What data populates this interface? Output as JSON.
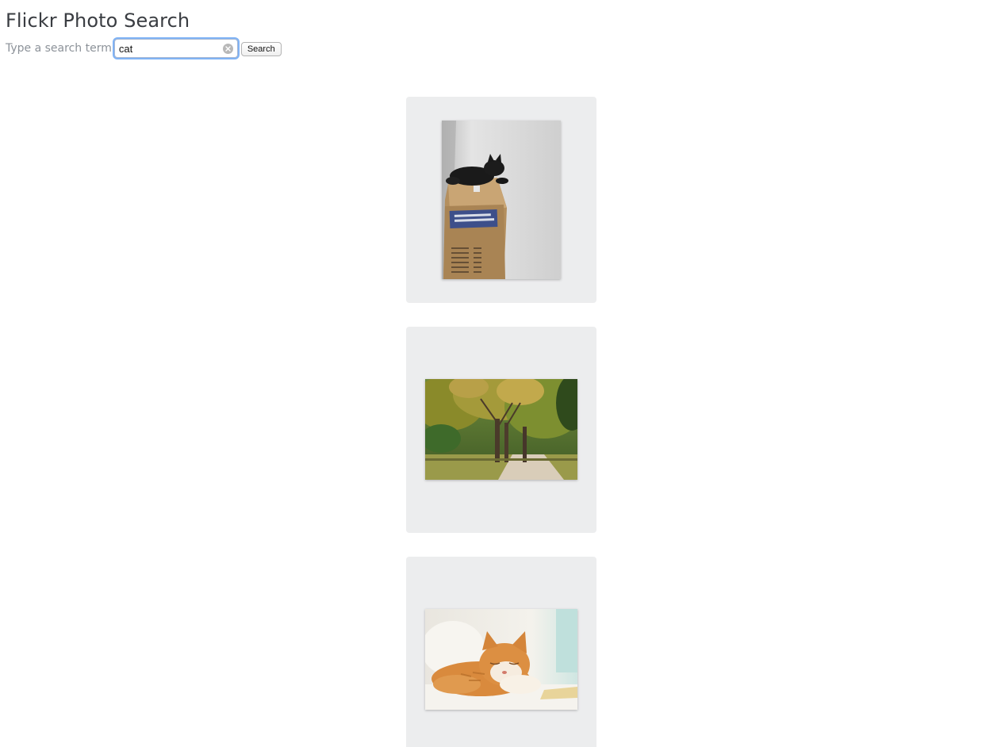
{
  "header": {
    "title": "Flickr Photo Search"
  },
  "search": {
    "label": "Type a search term",
    "value": "cat",
    "button_label": "Search",
    "clear_icon": "clear-icon"
  },
  "results": [
    {
      "subject": "black cat on cardboard box"
    },
    {
      "subject": "autumn trees along a path"
    },
    {
      "subject": "ginger cat sleeping"
    }
  ],
  "colors": {
    "focus_ring": "#80b3f5",
    "card_background": "#ecedee",
    "title_text": "#3a3d42",
    "label_text": "#8c9299"
  }
}
